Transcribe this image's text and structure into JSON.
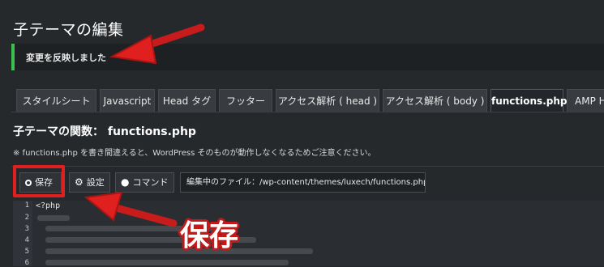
{
  "page": {
    "title": "子テーマの編集"
  },
  "notice": {
    "message": "変更を反映しました",
    "accent": "#3fbf4f"
  },
  "tabs": [
    {
      "label": "スタイルシート"
    },
    {
      "label": "Javascript"
    },
    {
      "label": "Head タグ"
    },
    {
      "label": "フッター"
    },
    {
      "label": "アクセス解析 ( head )"
    },
    {
      "label": "アクセス解析 ( body )"
    },
    {
      "label": "functions.php",
      "active": true
    },
    {
      "label": "AMP H"
    }
  ],
  "section": {
    "title": "子テーマの関数： functions.php",
    "warning": "※ functions.php を書き間違えると、WordPress そのものが動作しなくなるためご注意ください。"
  },
  "toolbar": {
    "save_label": "保存",
    "settings_label": "設定",
    "command_label": "コマンド",
    "file_path": "編集中のファイル：/wp-content/themes/luxech/functions.php"
  },
  "editor": {
    "line_numbers": [
      "1",
      "2",
      "3",
      "4",
      "5",
      "6"
    ],
    "first_line": "<?php"
  },
  "annotation": {
    "label": "保存",
    "color": "#e01f1f"
  }
}
